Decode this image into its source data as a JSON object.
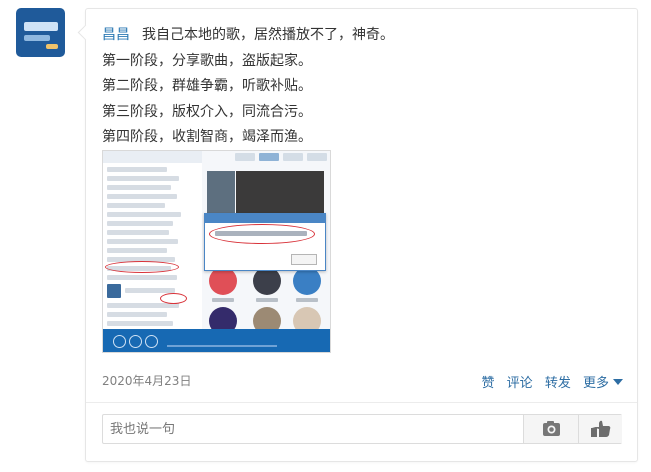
{
  "post": {
    "author": "昌昌",
    "lines": [
      "我自己本地的歌，居然播放不了，神奇。",
      "第一阶段，分享歌曲，盗版起家。",
      "第二阶段，群雄争霸，听歌补贴。",
      "第三阶段，版权介入，同流合污。",
      "第四阶段，收割智商，竭泽而渔。"
    ],
    "date": "2020年4月23日"
  },
  "actions": {
    "like": "赞",
    "comment": "评论",
    "share": "转发",
    "more": "更多"
  },
  "comment": {
    "placeholder": "我也说一句"
  },
  "icons": {
    "camera": "camera-icon",
    "emoji": "thumb-emoji-icon",
    "dropdown": "triangle-down-icon"
  },
  "colors": {
    "author": "#2d7ab4",
    "action_link": "#2d6da3",
    "player_bar": "#1769b3",
    "annotation": "#d8333a"
  }
}
